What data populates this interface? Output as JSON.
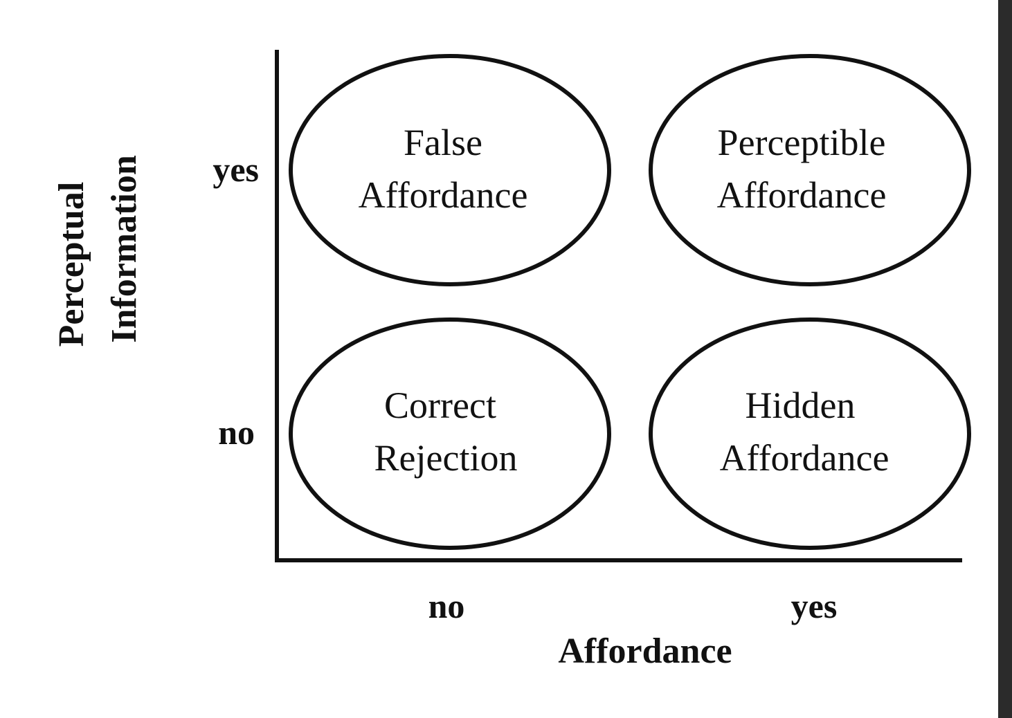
{
  "diagram": {
    "y_axis": {
      "title_lines": [
        "Perceptual",
        "Information"
      ],
      "values": [
        "yes",
        "no"
      ]
    },
    "x_axis": {
      "title": "Affordance",
      "values": [
        "no",
        "yes"
      ]
    },
    "cells": [
      {
        "lines": [
          "False",
          "Affordance"
        ]
      },
      {
        "lines": [
          "Perceptible",
          "Affordance"
        ]
      },
      {
        "lines": [
          "Correct",
          "Rejection"
        ]
      },
      {
        "lines": [
          "Hidden",
          "Affordance"
        ]
      }
    ]
  },
  "colors": {
    "ink": "#111111",
    "background": "#ffffff",
    "right_bar": "#2b2b2b"
  }
}
